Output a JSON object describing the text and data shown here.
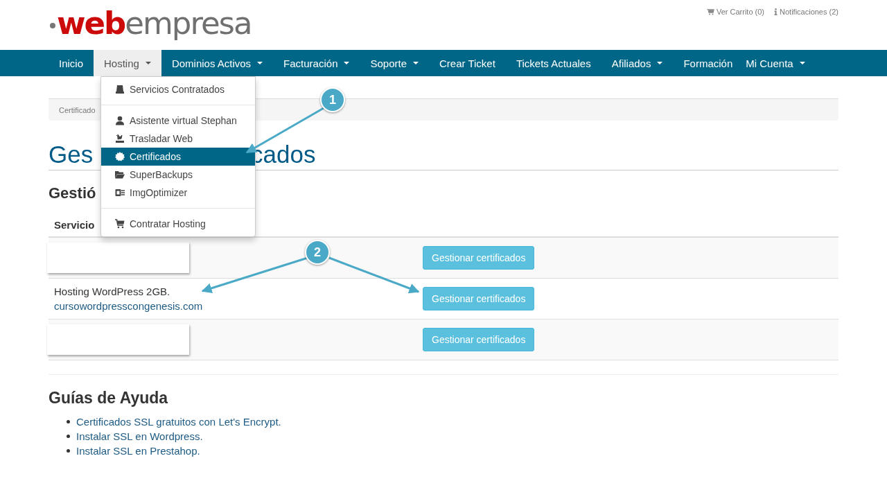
{
  "logo": {
    "part1": "web",
    "part2": "empresa"
  },
  "top_links": [
    {
      "label": "Ver Carrito (0)"
    },
    {
      "label": "Notificaciones (2)"
    }
  ],
  "nav": [
    {
      "label": "Inicio",
      "selected": false,
      "has_caret": false
    },
    {
      "label": "Hosting",
      "selected": true,
      "has_caret": true
    },
    {
      "label": "Dominios Activos",
      "selected": false,
      "has_caret": true
    },
    {
      "label": "Facturación",
      "selected": false,
      "has_caret": true
    },
    {
      "label": "Soporte",
      "selected": false,
      "has_caret": true
    },
    {
      "label": "Crear Ticket",
      "selected": false,
      "has_caret": false
    },
    {
      "label": "Tickets Actuales",
      "selected": false,
      "has_caret": false
    },
    {
      "label": "Afiliados",
      "selected": false,
      "has_caret": true
    },
    {
      "label": "Formación",
      "selected": false,
      "has_caret": false
    },
    {
      "label": "Mi Cuenta",
      "selected": false,
      "has_caret": true
    }
  ],
  "dropdown": {
    "groups": [
      [
        {
          "label": "Servicios Contratados",
          "selected": false
        }
      ],
      [
        {
          "label": "Asistente virtual Stephan",
          "selected": false
        },
        {
          "label": "Trasladar Web",
          "selected": false
        },
        {
          "label": "Certificados",
          "selected": true
        },
        {
          "label": "SuperBackups",
          "selected": false
        },
        {
          "label": "ImgOptimizer",
          "selected": false
        }
      ],
      [
        {
          "label": "Contratar Hosting",
          "selected": false
        }
      ]
    ]
  },
  "breadcrumb": {
    "visible_text": "Certificado"
  },
  "page_title": {
    "visible_start": "Ges",
    "visible_end": "cados"
  },
  "section_title": {
    "visible_text": "Gestió"
  },
  "table": {
    "columns": [
      {
        "label": "Servicio"
      }
    ],
    "rows": [
      {
        "redacted": true,
        "button": "Gestionar certificados"
      },
      {
        "redacted": false,
        "service": "Hosting WordPress 2GB.",
        "domain": "cursowordpresscongenesis.com",
        "button": "Gestionar certificados"
      },
      {
        "redacted": true,
        "button": "Gestionar certificados"
      }
    ]
  },
  "annotations": [
    {
      "number": "1"
    },
    {
      "number": "2"
    }
  ],
  "help": {
    "title": "Guías de Ayuda",
    "links": [
      "Certificados SSL gratuitos con Let's Encrypt.",
      "Instalar SSL en Wordpress.",
      "Instalar SSL en Prestahop."
    ]
  }
}
